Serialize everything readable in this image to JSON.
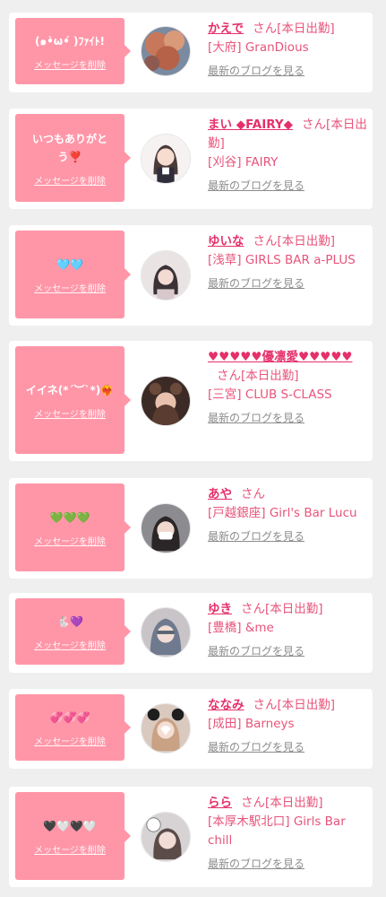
{
  "cards": [
    {
      "message": "(๑•̀ω•́ )ﾌｧｲﾄ!",
      "delete_label": "メッセージを削除",
      "name": "かえで",
      "suffix": "さん[本日出勤]",
      "shop": "[大府] GranDious",
      "blog_link": "最新のブログを見る",
      "avatar": "autumn-photo"
    },
    {
      "message": "いつもありがとう❣️",
      "delete_label": "メッセージを削除",
      "name": "まい ◆FAIRY◆",
      "suffix": "さん[本日出勤]",
      "shop": "[刈谷] FAIRY",
      "blog_link": "最新のブログを見る",
      "avatar": "illustration-girl"
    },
    {
      "message": "🩵🩵",
      "delete_label": "メッセージを削除",
      "name": "ゆいな",
      "suffix": "さん[本日出勤]",
      "shop": "[浅草] GIRLS BAR a-PLUS",
      "blog_link": "最新のブログを見る",
      "avatar": "selfie-light"
    },
    {
      "message": "イイネ(*´︶`*)❤️‍🔥",
      "delete_label": "メッセージを削除",
      "name": "♥♥♥♥♥優凛愛♥♥♥♥♥",
      "suffix": "さん[本日出勤]",
      "shop": "[三宮] CLUB S-CLASS",
      "blog_link": "最新のブログを見る",
      "avatar": "selfie-bear-ears"
    },
    {
      "message": "💚💚💚",
      "delete_label": "メッセージを削除",
      "name": "あや",
      "suffix": "さん",
      "shop": "[戸越銀座] Girl's Bar Lucu",
      "blog_link": "最新のブログを見る",
      "avatar": "selfie-mask"
    },
    {
      "message": "🐇💜",
      "delete_label": "メッセージを削除",
      "name": "ゆき",
      "suffix": "さん[本日出勤]",
      "shop": "[豊橋] &me",
      "blog_link": "最新のブログを見る",
      "avatar": "selfie-grey-hair"
    },
    {
      "message": "💞💞💞",
      "delete_label": "メッセージを削除",
      "name": "ななみ",
      "suffix": "さん[本日出勤]",
      "shop": "[成田] Barneys",
      "blog_link": "最新のブログを見る",
      "avatar": "selfie-heart-sticker"
    },
    {
      "message": "🖤🤍🖤🤍",
      "delete_label": "メッセージを削除",
      "name": "らら",
      "suffix": "さん[本日出勤]",
      "shop": "[本厚木駅北口] Girls Bar chill",
      "blog_link": "最新のブログを見る",
      "avatar": "selfie-kitty"
    }
  ]
}
